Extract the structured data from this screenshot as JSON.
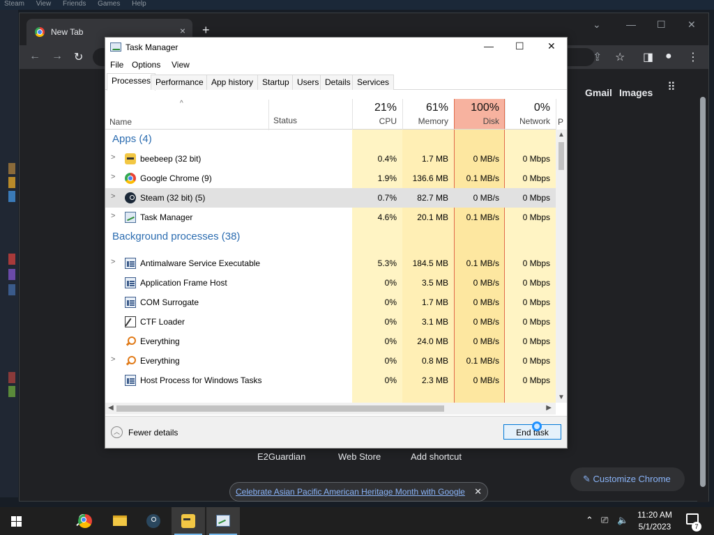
{
  "steam": {
    "menu": [
      "Steam",
      "View",
      "Friends",
      "Games",
      "Help"
    ]
  },
  "chrome": {
    "tab_title": "New Tab",
    "tab_close": "×",
    "new_tab": "+",
    "gmail": "Gmail",
    "images": "Images",
    "shortcuts": [
      "E2Guardian",
      "Web Store",
      "Add shortcut"
    ],
    "customize": "Customize Chrome",
    "promo": "Celebrate Asian Pacific American Heritage Month with Google",
    "promo_close": "✕"
  },
  "taskmanager": {
    "title": "Task Manager",
    "menu": [
      "File",
      "Options",
      "View"
    ],
    "tabs": [
      "Processes",
      "Performance",
      "App history",
      "Startup",
      "Users",
      "Details",
      "Services"
    ],
    "active_tab": "Processes",
    "columns": {
      "name": "Name",
      "status": "Status",
      "cpu": {
        "pct": "21%",
        "label": "CPU"
      },
      "memory": {
        "pct": "61%",
        "label": "Memory"
      },
      "disk": {
        "pct": "100%",
        "label": "Disk"
      },
      "network": {
        "pct": "0%",
        "label": "Network"
      },
      "next": "P"
    },
    "groups": {
      "apps": "Apps (4)",
      "background": "Background processes (38)"
    },
    "rows": [
      {
        "name": "beebeep (32 bit)",
        "cpu": "0.4%",
        "mem": "1.7 MB",
        "disk": "0 MB/s",
        "net": "0 Mbps"
      },
      {
        "name": "Google Chrome (9)",
        "cpu": "1.9%",
        "mem": "136.6 MB",
        "disk": "0.1 MB/s",
        "net": "0 Mbps"
      },
      {
        "name": "Steam (32 bit) (5)",
        "cpu": "0.7%",
        "mem": "82.7 MB",
        "disk": "0 MB/s",
        "net": "0 Mbps"
      },
      {
        "name": "Task Manager",
        "cpu": "4.6%",
        "mem": "20.1 MB",
        "disk": "0.1 MB/s",
        "net": "0 Mbps"
      },
      {
        "name": "Antimalware Service Executable",
        "cpu": "5.3%",
        "mem": "184.5 MB",
        "disk": "0.1 MB/s",
        "net": "0 Mbps"
      },
      {
        "name": "Application Frame Host",
        "cpu": "0%",
        "mem": "3.5 MB",
        "disk": "0 MB/s",
        "net": "0 Mbps"
      },
      {
        "name": "COM Surrogate",
        "cpu": "0%",
        "mem": "1.7 MB",
        "disk": "0 MB/s",
        "net": "0 Mbps"
      },
      {
        "name": "CTF Loader",
        "cpu": "0%",
        "mem": "3.1 MB",
        "disk": "0 MB/s",
        "net": "0 Mbps"
      },
      {
        "name": "Everything",
        "cpu": "0%",
        "mem": "24.0 MB",
        "disk": "0 MB/s",
        "net": "0 Mbps"
      },
      {
        "name": "Everything",
        "cpu": "0%",
        "mem": "0.8 MB",
        "disk": "0.1 MB/s",
        "net": "0 Mbps"
      },
      {
        "name": "Host Process for Windows Tasks",
        "cpu": "0%",
        "mem": "2.3 MB",
        "disk": "0 MB/s",
        "net": "0 Mbps"
      }
    ],
    "fewer_details": "Fewer details",
    "end_task": "End task"
  },
  "taskbar": {
    "time": "11:20 AM",
    "date": "5/1/2023",
    "notifications": "7"
  }
}
